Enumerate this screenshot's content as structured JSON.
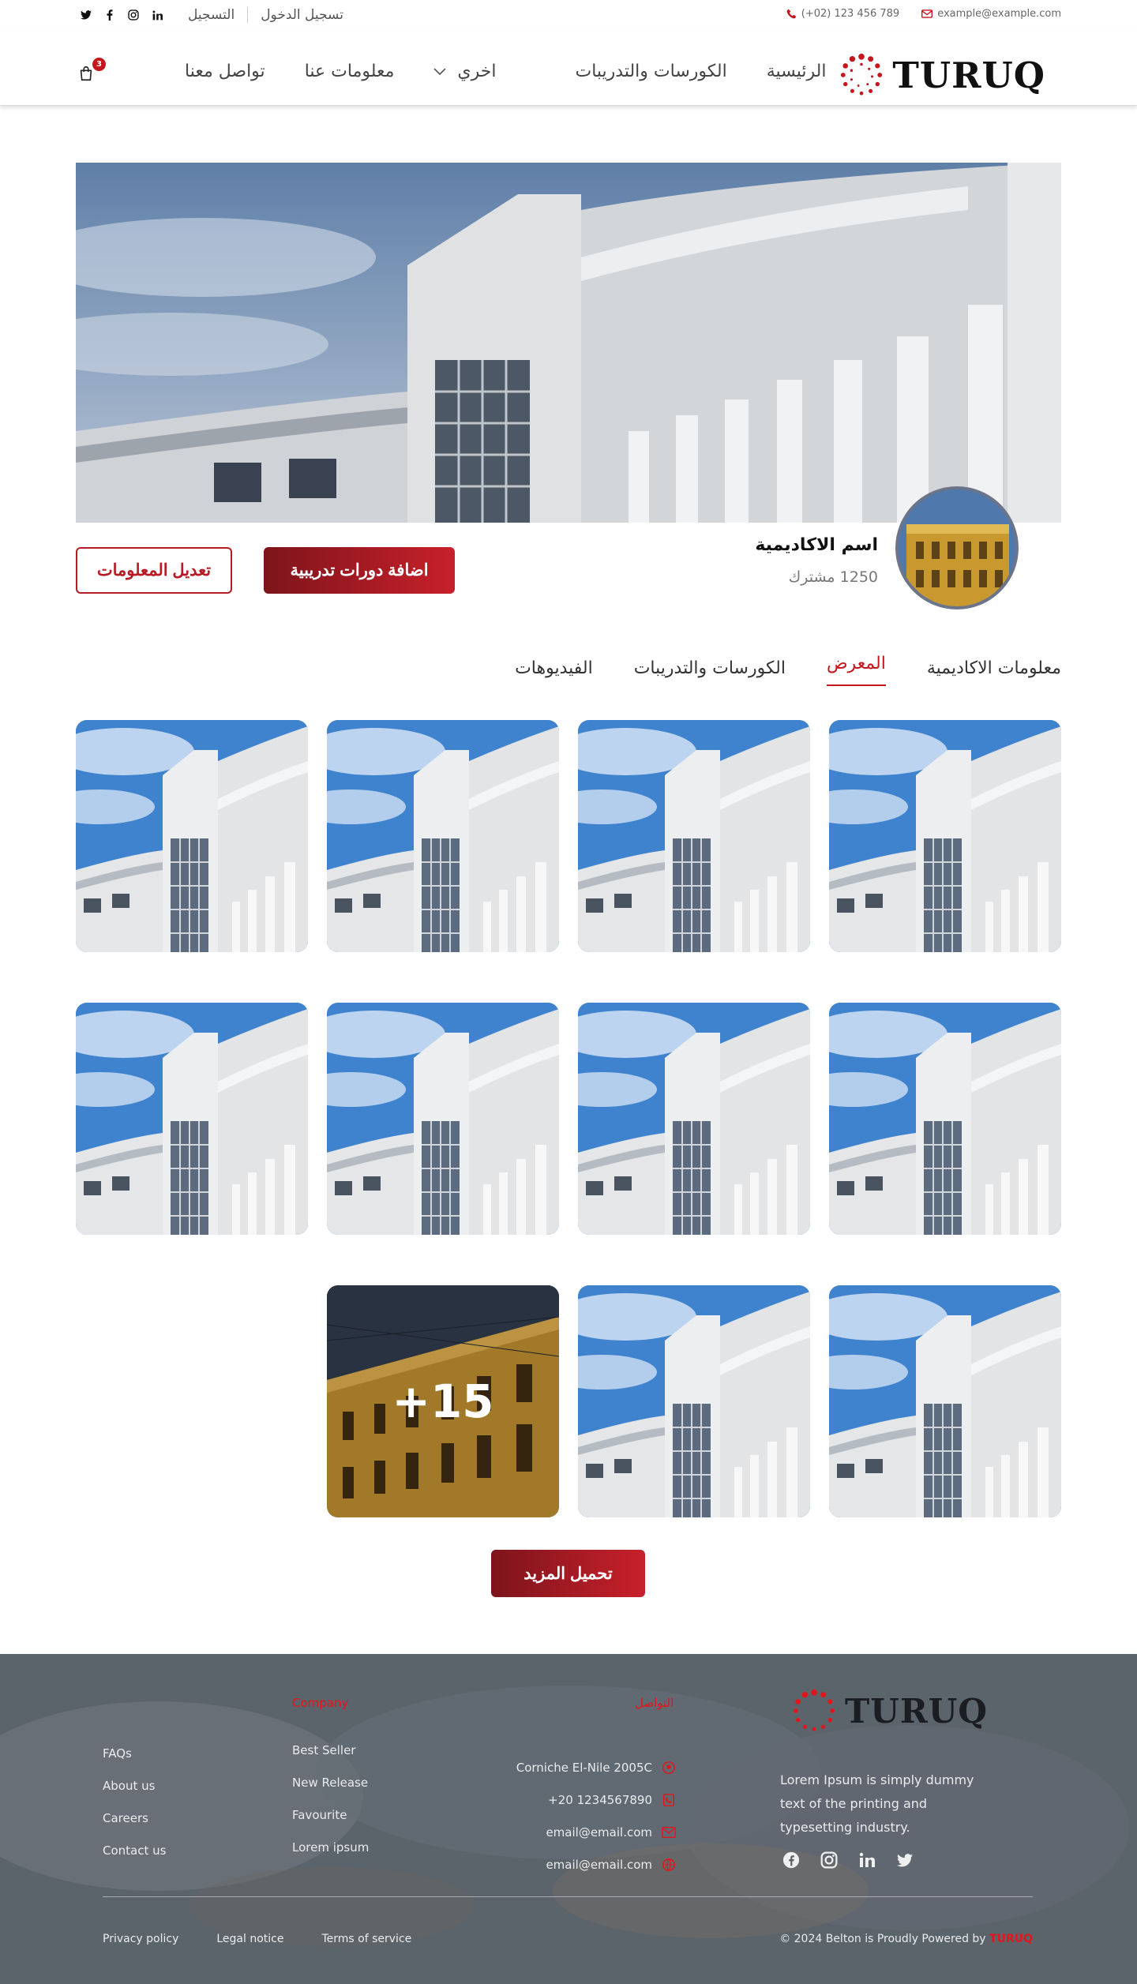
{
  "topbar": {
    "login": "تسجيل الدخول",
    "register": "التسجيل",
    "phone": "(+02) 123 456 789",
    "email": "example@example.com",
    "social_icons": [
      "twitter-icon",
      "facebook-icon",
      "instagram-icon",
      "linkedin-icon"
    ]
  },
  "nav": {
    "cart_count": "3",
    "links": [
      "تواصل معنا",
      "معلومات عنا",
      "اخري",
      "الكورسات والتدريبات",
      "الرئيسية"
    ],
    "logo_text": "TURUQ"
  },
  "profile": {
    "name": "اسم الاكاديمية",
    "subscribers": "1250 مشترك",
    "add_button": "اضافة دورات تدريبية",
    "edit_button": "تعديل المعلومات"
  },
  "tabs": [
    "معلومات الاكاديمية",
    "المعرض",
    "الكورسات والتدريبات",
    "الفيديوهات"
  ],
  "active_tab": "المعرض",
  "gallery": {
    "more_overlay": "+15",
    "load_more": "تحميل المزيد"
  },
  "footer": {
    "logo_text": "TURUQ",
    "about": "Lorem Ipsum is simply dummy text of the printing and typesetting industry.",
    "contact_heading": "التواصل",
    "contact": [
      "Corniche El-Nile 2005C",
      "+20 1234567890",
      "email@email.com",
      "email@email.com"
    ],
    "company_heading": "Company",
    "company_links": [
      "Best Seller",
      "New Release",
      "Favourite",
      "Lorem ipsum"
    ],
    "help_links": [
      "FAQs",
      "About us",
      "Careers",
      "Contact us"
    ],
    "legal": [
      "Privacy policy",
      "Legal notice",
      "Terms of service"
    ],
    "copyright": "© 2024 Belton is Proudly Powered by",
    "copyright_brand": "TURUQ"
  },
  "colors": {
    "accent": "#c4161c",
    "dark_accent": "#7d141b",
    "footer_bg": "#5a6169"
  }
}
